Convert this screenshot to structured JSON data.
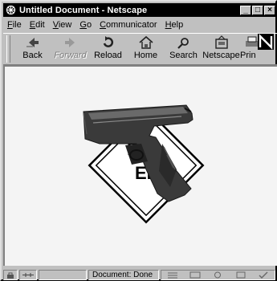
{
  "window": {
    "title": "Untitled Document - Netscape"
  },
  "menu": [
    {
      "label": "ile",
      "mnemonic": "F"
    },
    {
      "label": "dit",
      "mnemonic": "E"
    },
    {
      "label": "iew",
      "mnemonic": "V"
    },
    {
      "label": "o",
      "mnemonic": "G"
    },
    {
      "label": "ommunicator",
      "mnemonic": "C"
    },
    {
      "label": "elp",
      "mnemonic": "H"
    }
  ],
  "toolbar": {
    "back": "Back",
    "forward": "Forward",
    "reload": "Reload",
    "home": "Home",
    "search": "Search",
    "netscape": "Netscape",
    "print": "Prin"
  },
  "content": {
    "sign_text_top": "DE",
    "sign_text_bottom": "END"
  },
  "status": {
    "text": "Document: Done"
  },
  "colors": {
    "sign_yellow": "#ffffff",
    "window_gray": "#c0c0c0"
  }
}
